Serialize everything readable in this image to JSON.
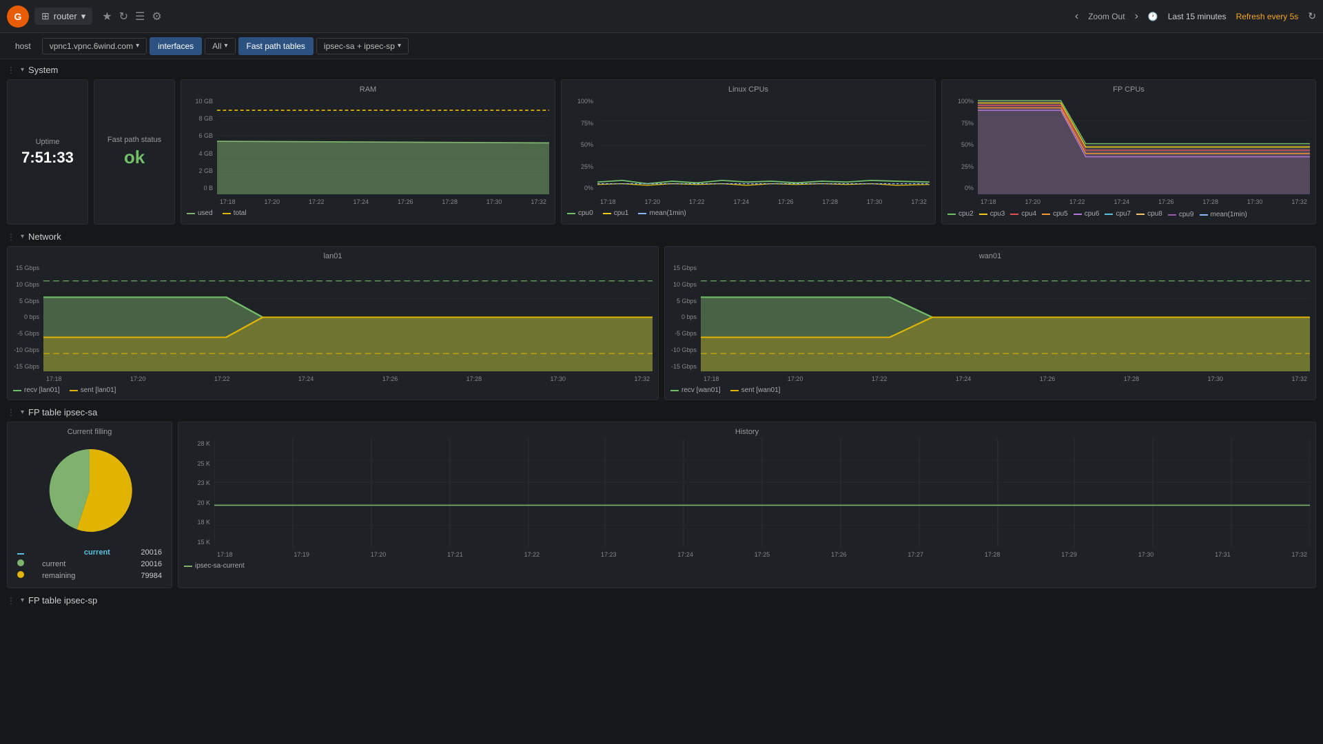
{
  "topnav": {
    "logo": "G",
    "app_icon": "⊞",
    "app_name": "router",
    "dropdown_arrow": "▾",
    "icons": [
      "★",
      "↻",
      "☰",
      "⚙"
    ],
    "zoom_out": "Zoom Out",
    "zoom_left": "‹",
    "zoom_right": "›",
    "clock_icon": "🕐",
    "time_range": "Last 15 minutes",
    "refresh_label": "Refresh every 5s",
    "refresh_icon": "↻"
  },
  "tabbar": {
    "host": "host",
    "vpnc1": "vpnc1.vpnc.6wind.com",
    "interfaces": "interfaces",
    "all": "All",
    "fastpath": "Fast path tables",
    "ipsec": "ipsec-sa + ipsec-sp",
    "ipsec_arrow": "▾",
    "all_arrow": "▾",
    "vpnc1_arrow": "▾"
  },
  "system": {
    "section_label": "System",
    "uptime_label": "Uptime",
    "uptime_value": "7:51:33",
    "fastpath_label": "Fast path status",
    "fastpath_value": "ok",
    "ram_label": "RAM",
    "linux_cpu_label": "Linux CPUs",
    "fp_cpu_label": "FP CPUs",
    "ram": {
      "y_labels": [
        "10 GB",
        "8 GB",
        "6 GB",
        "4 GB",
        "2 GB",
        "0 B"
      ],
      "x_labels": [
        "17:18",
        "17:20",
        "17:22",
        "17:24",
        "17:26",
        "17:28",
        "17:30",
        "17:32"
      ],
      "legend_used": "used",
      "legend_total": "total",
      "used_color": "#7eb26d",
      "total_color": "#e0b400"
    },
    "linux_cpu": {
      "y_labels": [
        "100%",
        "75%",
        "50%",
        "25%",
        "0%"
      ],
      "x_labels": [
        "17:18",
        "17:20",
        "17:22",
        "17:24",
        "17:26",
        "17:28",
        "17:30",
        "17:32"
      ],
      "legend_cpu0": "cpu0",
      "legend_cpu1": "cpu1",
      "legend_mean": "mean(1min)",
      "cpu0_color": "#73bf69",
      "cpu1_color": "#f2cc0c",
      "mean_color": "#8ab8ff"
    },
    "fp_cpu": {
      "y_labels": [
        "100%",
        "75%",
        "50%",
        "25%",
        "0%"
      ],
      "x_labels": [
        "17:18",
        "17:20",
        "17:22",
        "17:24",
        "17:26",
        "17:28",
        "17:30",
        "17:32"
      ],
      "cpus": [
        "cpu2",
        "cpu3",
        "cpu4",
        "cpu5",
        "cpu6",
        "cpu7",
        "cpu8",
        "cpu9",
        "mean(1min)"
      ],
      "colors": [
        "#73bf69",
        "#f2cc0c",
        "#e05151",
        "#ff9830",
        "#b877d9",
        "#5bc0de",
        "#f9c46b",
        "#9b59b6",
        "#8ab8ff"
      ]
    }
  },
  "network": {
    "section_label": "Network",
    "lan01": {
      "title": "lan01",
      "y_labels": [
        "15 Gbps",
        "10 Gbps",
        "5 Gbps",
        "0 bps",
        "-5 Gbps",
        "-10 Gbps",
        "-15 Gbps"
      ],
      "x_labels": [
        "17:18",
        "17:20",
        "17:22",
        "17:24",
        "17:26",
        "17:28",
        "17:30",
        "17:32"
      ],
      "legend_recv": "recv [lan01]",
      "legend_sent": "sent [lan01]",
      "recv_color": "#73bf69",
      "sent_color": "#e0b400"
    },
    "wan01": {
      "title": "wan01",
      "y_labels": [
        "15 Gbps",
        "10 Gbps",
        "5 Gbps",
        "0 bps",
        "-5 Gbps",
        "-10 Gbps",
        "-15 Gbps"
      ],
      "x_labels": [
        "17:18",
        "17:20",
        "17:22",
        "17:24",
        "17:26",
        "17:28",
        "17:30",
        "17:32"
      ],
      "legend_recv": "recv [wan01]",
      "legend_sent": "sent [wan01]",
      "recv_color": "#73bf69",
      "sent_color": "#e0b400"
    }
  },
  "fp_ipsec_sa": {
    "section_label": "FP table ipsec-sa",
    "pie_title": "Current filling",
    "current_label": "current",
    "remaining_label": "remaining",
    "current_value": "20016",
    "remaining_value": "79984",
    "current_color": "#7eb26d",
    "remaining_color": "#e0b400",
    "history_title": "History",
    "y_labels": [
      "28 K",
      "25 K",
      "23 K",
      "20 K",
      "18 K",
      "15 K"
    ],
    "x_labels": [
      "17:18",
      "17:19",
      "17:20",
      "17:21",
      "17:22",
      "17:23",
      "17:24",
      "17:25",
      "17:26",
      "17:27",
      "17:28",
      "17:29",
      "17:30",
      "17:31",
      "17:32"
    ],
    "legend_current": "ipsec-sa-current",
    "line_color": "#7eb26d"
  },
  "fp_ipsec_sp": {
    "section_label": "FP table ipsec-sp"
  }
}
